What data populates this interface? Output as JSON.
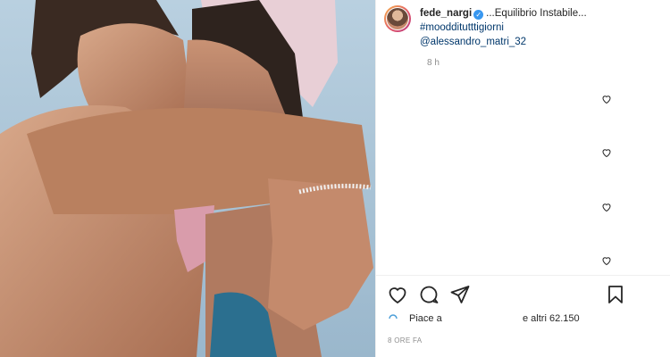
{
  "post": {
    "username": "fede_nargi",
    "verified_icon": "verified-badge-icon",
    "caption_text": "...Equilibrio Instabile...",
    "hashtag": "#moodditutttigiorni",
    "mention": "@alessandro_matri_32",
    "relative_time": "8 h",
    "likes_prefix": "Piace a",
    "likes_suffix": "e altri 62.150",
    "post_time": "8 ORE FA"
  },
  "photo": {
    "description_icon": "couple-photo"
  },
  "colors": {
    "link": "#00376b",
    "verified": "#3897f0",
    "muted": "#8e8e8e"
  }
}
